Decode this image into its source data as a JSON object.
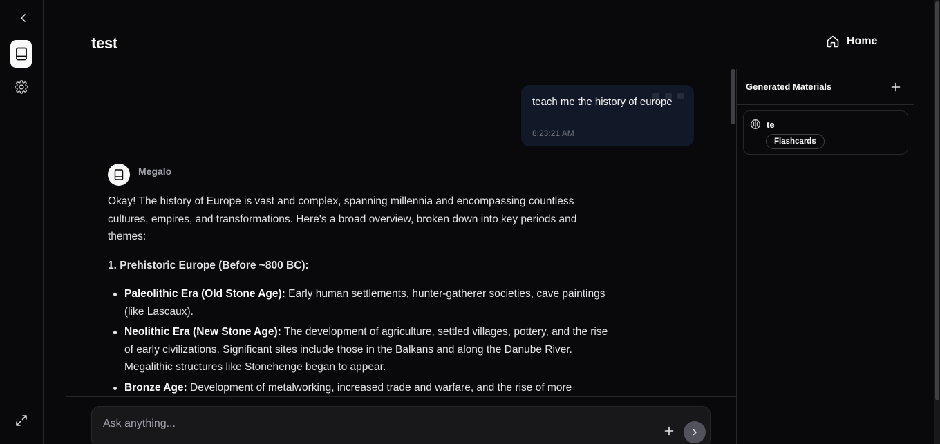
{
  "header": {
    "title": "test",
    "home_label": "Home"
  },
  "rail": {
    "icons": [
      "chevron-left-icon",
      "notebook-icon",
      "gear-icon",
      "expand-icon"
    ]
  },
  "chat": {
    "user_message": {
      "text": "teach me the history of europe",
      "time": "8:23:21 AM"
    },
    "bot": {
      "name": "Megalo",
      "intro": "Okay! The history of Europe is vast and complex, spanning millennia and encompassing countless cultures, empires, and transformations. Here's a broad overview, broken down into key periods and themes:",
      "section_heading": "1. Prehistoric Europe (Before ~800 BC):",
      "items": [
        {
          "term": "Paleolithic Era (Old Stone Age):",
          "text": " Early human settlements, hunter-gatherer societies, cave paintings (like Lascaux)."
        },
        {
          "term": "Neolithic Era (New Stone Age):",
          "text": " The development of agriculture, settled villages, pottery, and the rise of early civilizations. Significant sites include those in the Balkans and along the Danube River. Megalithic structures like Stonehenge began to appear."
        },
        {
          "term": "Bronze Age:",
          "text": " Development of metalworking, increased trade and warfare, and the rise of more"
        }
      ]
    }
  },
  "composer": {
    "placeholder": "Ask anything..."
  },
  "panel": {
    "title": "Generated Materials",
    "materials": [
      {
        "name": "te",
        "type": "Flashcards"
      }
    ]
  },
  "colors": {
    "background": "#09090b",
    "user_bubble": "#111827",
    "border": "#27272a"
  }
}
